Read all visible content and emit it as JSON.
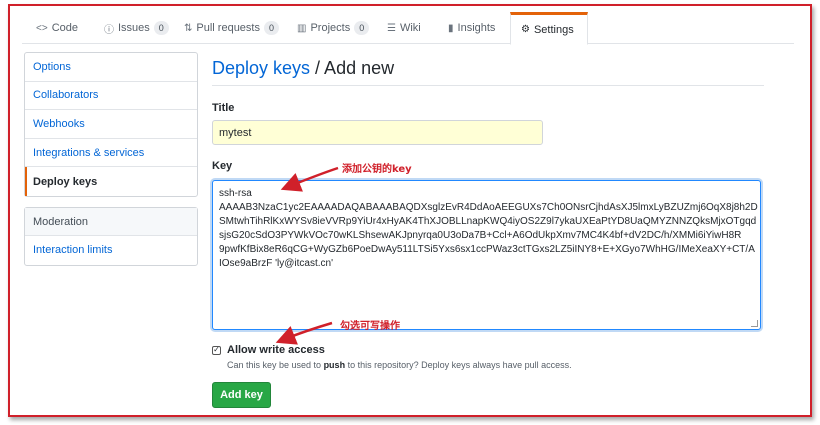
{
  "tabs": [
    {
      "icon": "<>",
      "label": "Code"
    },
    {
      "icon": "ⓘ",
      "label": "Issues",
      "count": "0"
    },
    {
      "icon": "⇅",
      "label": "Pull requests",
      "count": "0"
    },
    {
      "icon": "▥",
      "label": "Projects",
      "count": "0"
    },
    {
      "icon": "☰",
      "label": "Wiki"
    },
    {
      "icon": "▮",
      "label": "Insights"
    },
    {
      "icon": "⚙",
      "label": "Settings"
    }
  ],
  "sidebar": {
    "items": [
      {
        "label": "Options"
      },
      {
        "label": "Collaborators"
      },
      {
        "label": "Webhooks"
      },
      {
        "label": "Integrations & services"
      },
      {
        "label": "Deploy keys"
      }
    ],
    "moderation": {
      "heading": "Moderation",
      "items": [
        {
          "label": "Interaction limits"
        }
      ]
    }
  },
  "main": {
    "title_link": "Deploy keys",
    "title_rest": " / Add new",
    "title_label": "Title",
    "title_value": "mytest",
    "key_label": "Key",
    "key_lines": [
      "ssh-rsa",
      "AAAAB3NzaC1yc2EAAAADAQABAAABAQDXsglzEvR4DdAoAEEGUXs7Ch0ONsrCjhdAsXJ5lmxLyBZUZmj6OqX8j8h2D",
      "SMtwhTihRlKxWYSv8ieVVRp9YiUr4xHyAK4ThXJOBLLnapKWQ4iyOS2Z9l7ykaUXEaPtYD8UaQMYZNNZQksMjxOTgqd",
      "sjsG20cSdO3PYWkVOc70wKLShsewAKJpnyrqa0U3oDa7B+Ccl+A6OdUkpXmv7MC4K4bf+dV2DC/h/XMMi6iYiwH8R",
      "9pwfKfBix8eR6qCG+WyGZb6PoeDwAy511LTSi5Yxs6sx1ccPWaz3ctTGxs2LZ5iINY8+E+XGyo7WhHG/IMeXeaXY+CT/A",
      "IOse9aBrzF 'ly@itcast.cn'"
    ],
    "allow_write_label": "Allow write access",
    "note_before": "Can this key be used to ",
    "note_bold": "push",
    "note_after": " to this repository? Deploy keys always have pull access.",
    "add_button": "Add key"
  },
  "annotations": {
    "key_note": "添加公钥的key",
    "write_note": "勾选可写操作",
    "color": "#d0202a"
  },
  "colors": {
    "accent_tab": "#e36209",
    "link": "#0366d6",
    "button": "#28a745",
    "title_input_bg": "#ffffd6"
  }
}
